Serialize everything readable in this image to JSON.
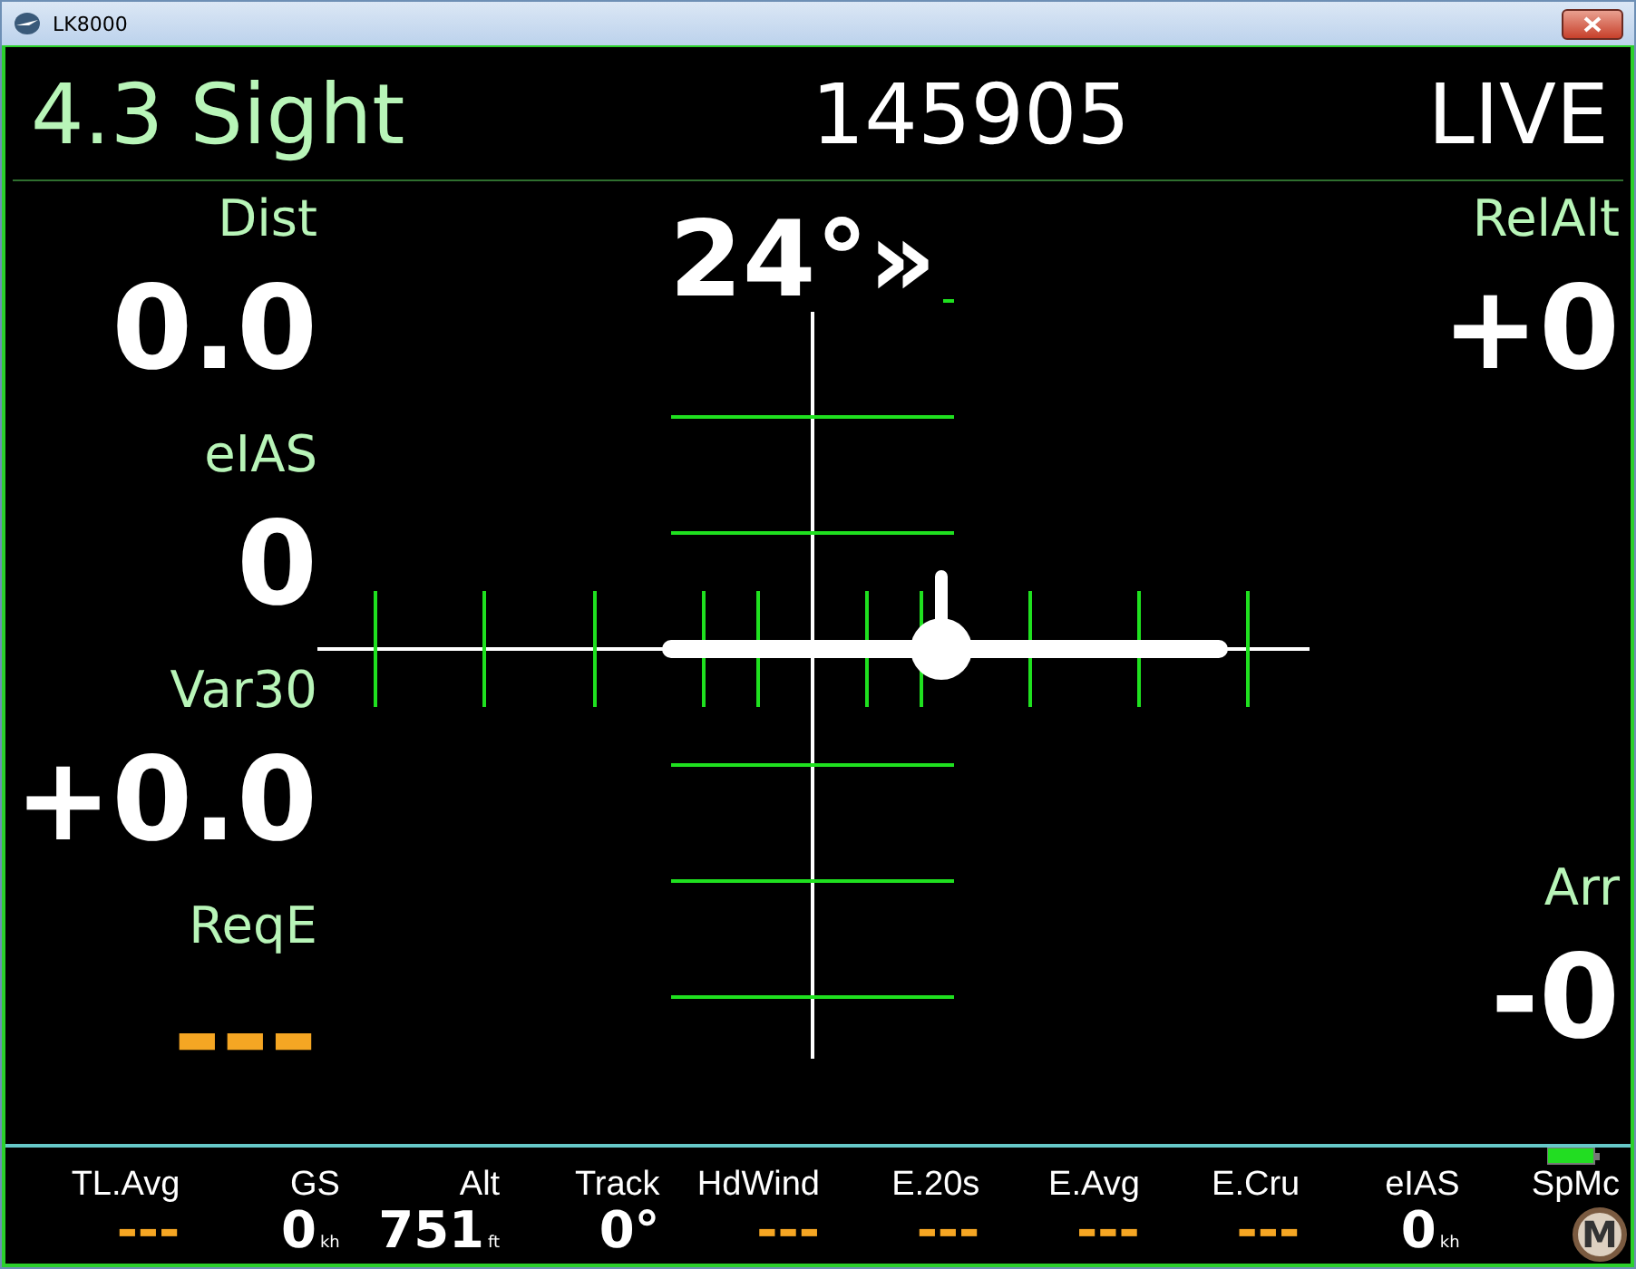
{
  "window": {
    "title": "LK8000"
  },
  "header": {
    "mode": "4.3 Sight",
    "waypoint": "145905",
    "status": "LIVE"
  },
  "left_panel": [
    {
      "label": "Dist",
      "value": "0.0",
      "kind": "value"
    },
    {
      "label": "eIAS",
      "value": "0",
      "kind": "value"
    },
    {
      "label": "Var30",
      "value": "+0.0",
      "kind": "value"
    },
    {
      "label": "ReqE",
      "value": "---",
      "kind": "invalid"
    }
  ],
  "right_panel": [
    {
      "label": "RelAlt",
      "value": "+0"
    },
    {
      "label": "Arr",
      "value": "-0"
    }
  ],
  "sight": {
    "bearing": "24°",
    "turn_hint": "»"
  },
  "bottom_bar": [
    {
      "label": "TL.Avg",
      "value": "---",
      "kind": "invalid"
    },
    {
      "label": "GS",
      "value": "0",
      "unit": "kh",
      "kind": "value"
    },
    {
      "label": "Alt",
      "value": "751",
      "unit": "ft",
      "kind": "value"
    },
    {
      "label": "Track",
      "value": "0°",
      "kind": "value"
    },
    {
      "label": "HdWind",
      "value": "---",
      "kind": "invalid"
    },
    {
      "label": "E.20s",
      "value": "---",
      "kind": "invalid"
    },
    {
      "label": "E.Avg",
      "value": "---",
      "kind": "invalid"
    },
    {
      "label": "E.Cru",
      "value": "---",
      "kind": "invalid"
    },
    {
      "label": "eIAS",
      "value": "0",
      "unit": "kh",
      "kind": "value"
    },
    {
      "label": "SpMc"
    }
  ],
  "mode_badge": "M"
}
